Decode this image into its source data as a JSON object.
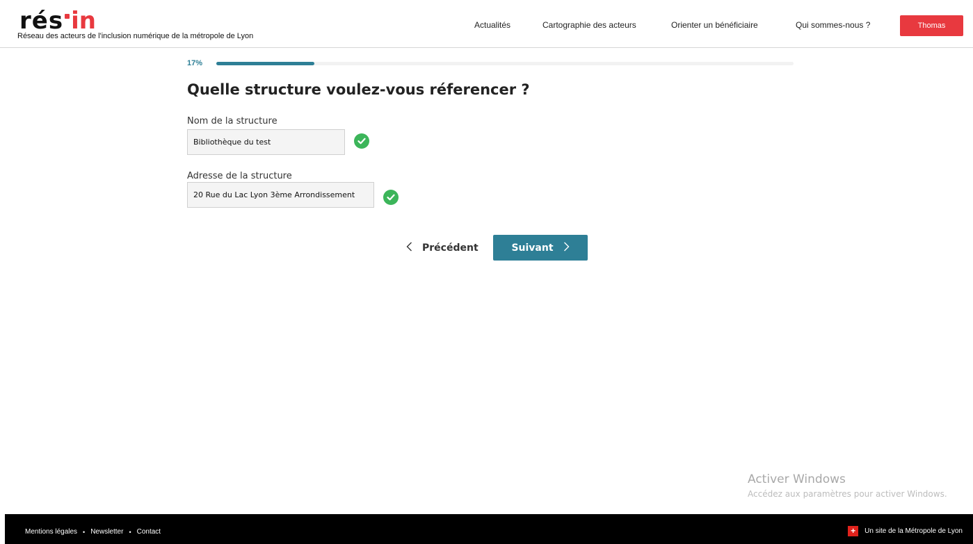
{
  "brand": {
    "logo_res": "rés",
    "logo_in": "in",
    "tagline": "Réseau des acteurs de l'inclusion numérique de la métropole de Lyon"
  },
  "nav": {
    "items": [
      "Actualités",
      "Cartographie des acteurs",
      "Orienter un bénéficiaire",
      "Qui sommes-nous ?"
    ],
    "user_label": "Thomas"
  },
  "progress": {
    "label": "17%",
    "value": 17
  },
  "form": {
    "title": "Quelle structure voulez-vous réferencer ?",
    "name_label": "Nom de la structure",
    "name_value": "Bibliothèque du test",
    "address_label": "Adresse de la structure",
    "address_value": "20 Rue du Lac Lyon 3ème Arrondissement"
  },
  "actions": {
    "prev_label": "Précédent",
    "next_label": "Suivant"
  },
  "watermark": {
    "title": "Activer Windows",
    "subtitle": "Accédez aux paramètres pour activer Windows."
  },
  "footer": {
    "links": [
      "Mentions légales",
      "Newsletter",
      "Contact"
    ],
    "separator": "•",
    "metro_label": "Un site de la Métropole de Lyon",
    "metro_flag": "+"
  },
  "colors": {
    "accent": "#2e7f96",
    "brand_red": "#e8393f",
    "success": "#3cb55a"
  }
}
